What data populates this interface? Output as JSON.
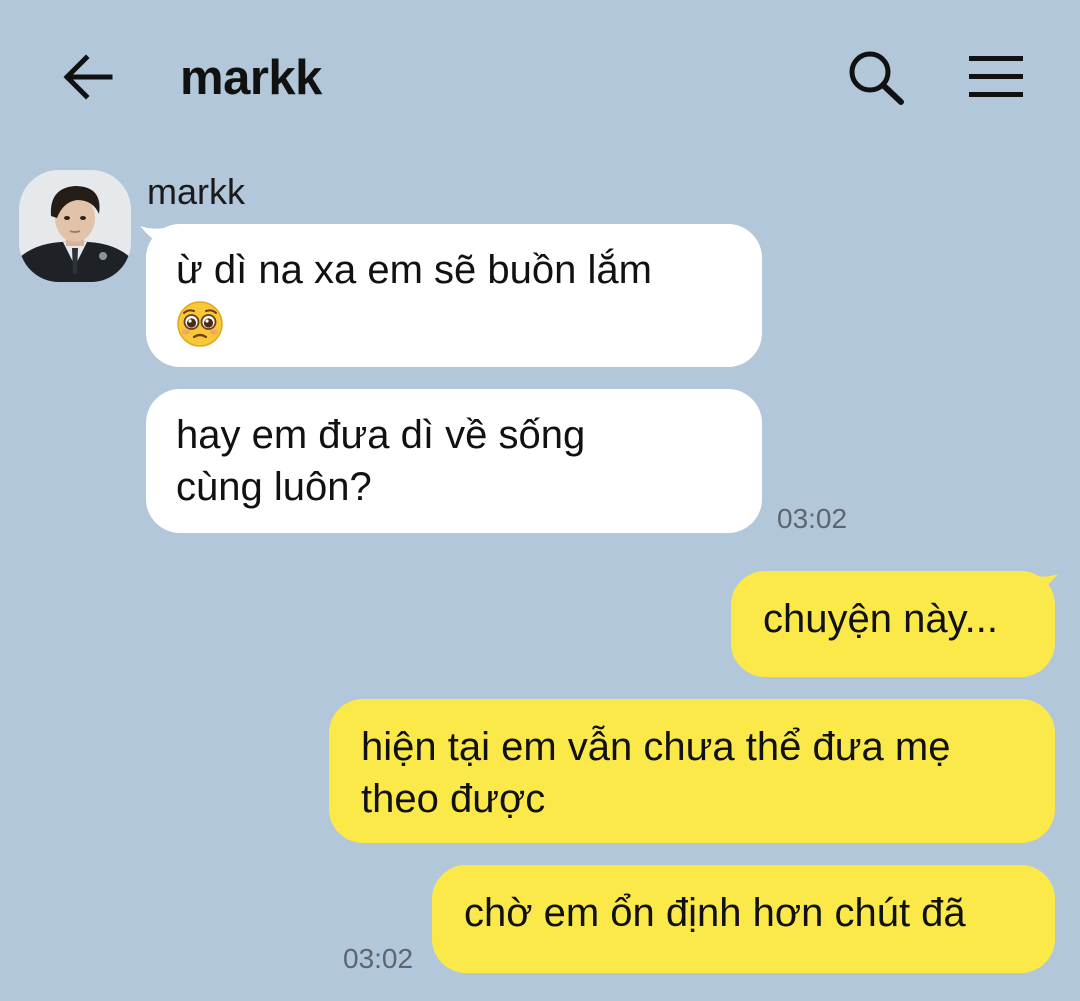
{
  "header": {
    "title": "markk",
    "icons": {
      "back": "arrow-left-icon",
      "search": "search-icon",
      "menu": "hamburger-menu-icon"
    }
  },
  "colors": {
    "background": "#b2c7da",
    "incoming_bubble": "#ffffff",
    "outgoing_bubble": "#fbe94a",
    "timestamp": "#5d6670"
  },
  "conversation": {
    "incoming": {
      "sender": "markk",
      "messages": [
        {
          "line1": "ừ dì na xa em sẽ buồn lắm",
          "emoji": "pleading-face-emoji"
        },
        {
          "line1": "hay em đưa dì về sống",
          "line2": "cùng luôn?"
        }
      ],
      "time": "03:02"
    },
    "outgoing": {
      "messages": [
        {
          "line1": "chuyện này..."
        },
        {
          "line1": "hiện tại em vẫn chưa thể đưa mẹ",
          "line2": "theo được"
        },
        {
          "line1": "chờ em ổn định hơn chút đã"
        }
      ],
      "time": "03:02"
    }
  }
}
